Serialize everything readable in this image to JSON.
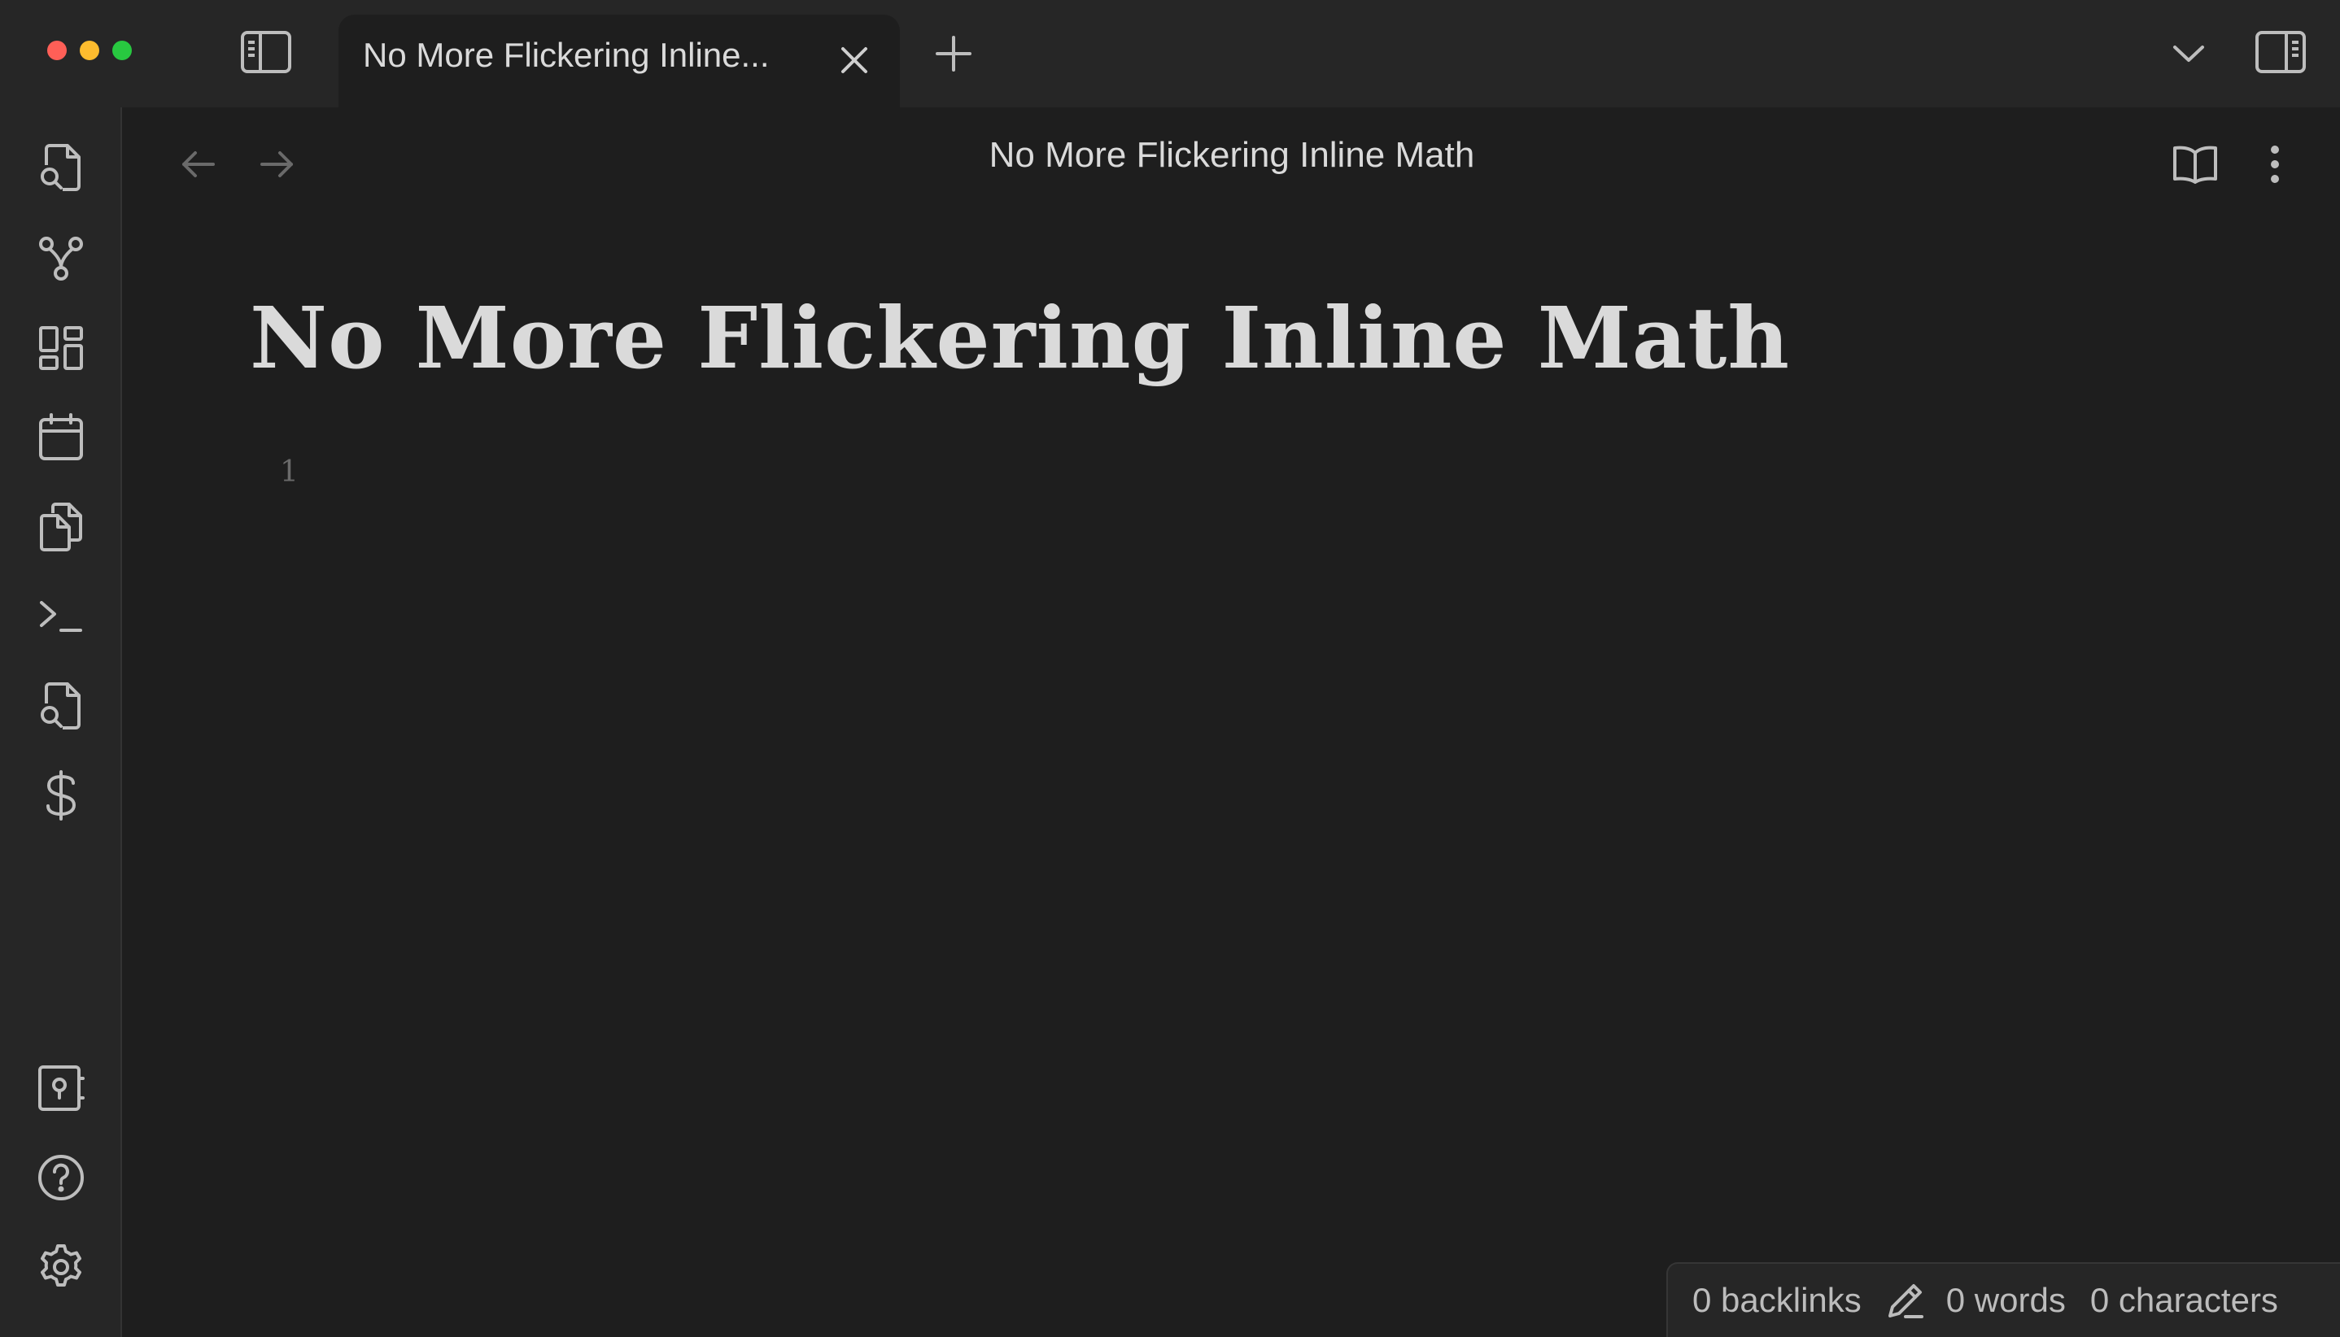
{
  "window": {
    "tab_title": "No More Flickering Inline...",
    "view_title": "No More Flickering Inline Math"
  },
  "document": {
    "title": "No More Flickering Inline Math",
    "line_number": "1"
  },
  "status_bar": {
    "backlinks": "0 backlinks",
    "words": "0 words",
    "characters": "0 characters"
  },
  "ribbon": {
    "icons": [
      "file-search-icon",
      "graph-icon",
      "dashboard-icon",
      "calendar-icon",
      "copy-icon",
      "terminal-icon",
      "file-search-icon",
      "dollar-icon"
    ],
    "bottom_icons": [
      "vault-icon",
      "help-icon",
      "settings-icon"
    ]
  },
  "colors": {
    "background": "#1e1e1e",
    "titlebar": "#262626",
    "text": "#dadada",
    "muted": "#6b6b6b"
  }
}
